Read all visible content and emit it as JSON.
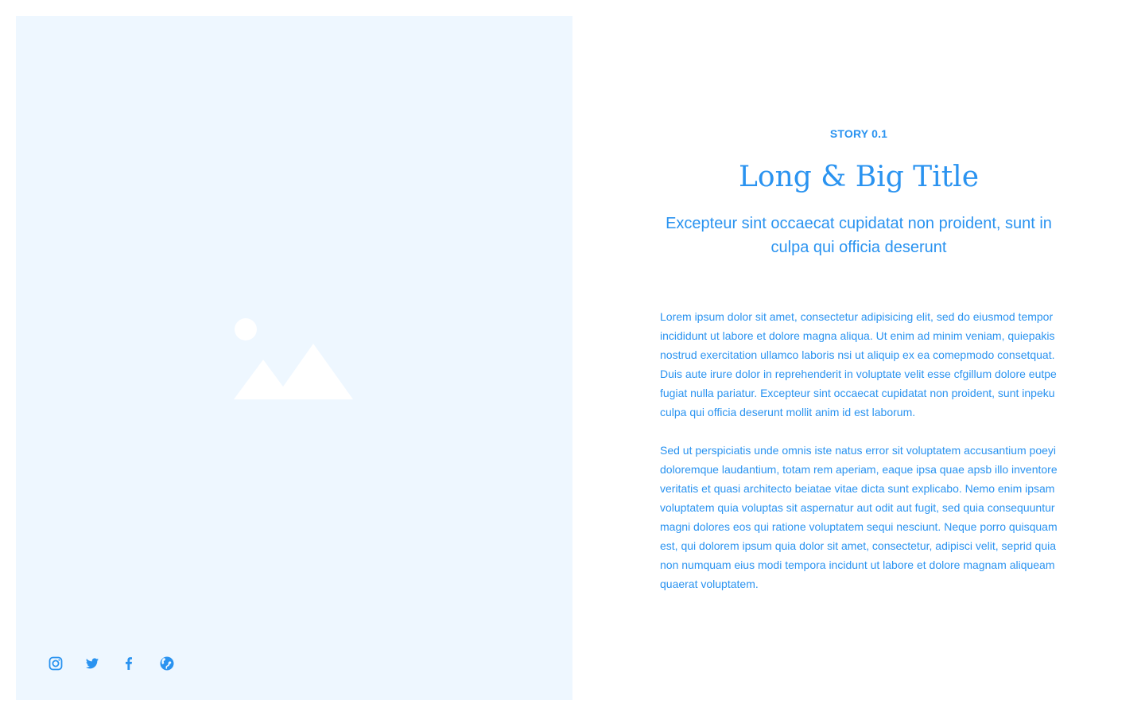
{
  "colors": {
    "accent": "#2a93f0",
    "panel_background": "#eef7ff",
    "placeholder_shapes": "#ffffff",
    "page_background": "#ffffff"
  },
  "media": {
    "placeholder_icon": "image-placeholder-icon"
  },
  "social": [
    {
      "icon": "instagram-icon"
    },
    {
      "icon": "twitter-icon"
    },
    {
      "icon": "facebook-icon"
    },
    {
      "icon": "globe-icon"
    }
  ],
  "story": {
    "eyebrow": "STORY 0.1",
    "title": "Long & Big Title",
    "subtitle": "Excepteur sint occaecat cupidatat non proident, sunt in culpa qui officia deserunt",
    "paragraphs": [
      "Lorem ipsum dolor sit amet, consectetur adipisicing elit, sed do eiusmod tempor incididunt ut labore et dolore magna aliqua. Ut enim ad minim veniam, quiepakis nostrud exercitation ullamco laboris nsi ut aliquip ex ea comepmodo consetquat. Duis aute irure dolor in reprehenderit in voluptate velit esse cfgillum dolore eutpe fugiat nulla pariatur. Excepteur sint occaecat cupidatat non proident, sunt inpeku culpa qui officia deserunt mollit anim id est laborum.",
      "Sed ut perspiciatis unde omnis iste natus error sit voluptatem accusantium poeyi doloremque laudantium, totam rem aperiam, eaque ipsa quae apsb illo inventore veritatis et quasi architecto beiatae vitae dicta sunt explicabo. Nemo enim ipsam voluptatem quia voluptas sit aspernatur aut odit aut fugit, sed quia consequuntur magni dolores eos qui ratione voluptatem sequi nesciunt. Neque porro quisquam est, qui dolorem ipsum quia dolor sit amet, consectetur, adipisci velit, seprid quia non numquam eius modi tempora incidunt ut labore et dolore magnam aliqueam quaerat voluptatem."
    ]
  }
}
